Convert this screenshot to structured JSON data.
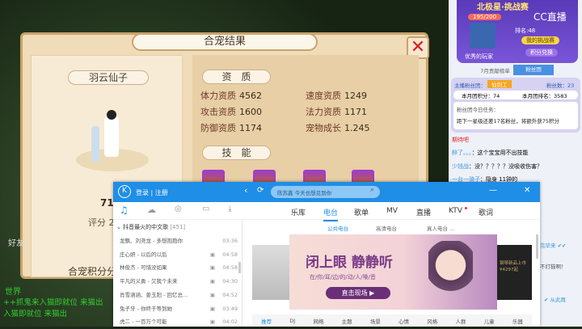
{
  "game": {
    "title": "合宠结果",
    "close": "✕",
    "pet_name": "羽云仙子",
    "score_partial": "71",
    "rating_label": "评分 2",
    "points_label": "合宠积分分",
    "aptitude_header": "资　质",
    "skills_header": "技　能",
    "stats": [
      {
        "label": "体力资质",
        "value": "4562"
      },
      {
        "label": "速度资质",
        "value": "1249"
      },
      {
        "label": "攻击资质",
        "value": "1600"
      },
      {
        "label": "法力资质",
        "value": "1171"
      },
      {
        "label": "防御资质",
        "value": "1174"
      },
      {
        "label": "宠物成长",
        "value": "1.245"
      }
    ],
    "friends": "好友",
    "chat_channel": "世界",
    "chat_lines": [
      "++抓鬼来入猫即就位 来猫出",
      "入猫即就位 来猫出"
    ]
  },
  "kugou": {
    "login": "登录 | 注册",
    "search_placeholder": "陈苏鑫 今天也想见到你",
    "tabs": [
      "乐库",
      "电台",
      "歌单",
      "MV",
      "直播",
      "KTV",
      "歌词"
    ],
    "active_tab": "电台",
    "subtabs": [
      "公共电台",
      "高清电台",
      "真人电台 ..."
    ],
    "playlist_title": "抖音最火的中文歌",
    "playlist_count": "[451]",
    "songs": [
      {
        "name": "龙飘、刘尧龙 - 多想抱抱你",
        "time": "03:36"
      },
      {
        "name": "庄心妍 - 以后的以后",
        "time": "04:58"
      },
      {
        "name": "林俊杰 - 可惜没如果",
        "time": "04:58"
      },
      {
        "name": "平凡的义勇 - 欠我个未来",
        "time": "04:30"
      },
      {
        "name": "肖雪涵涵、姜玉阳 - 回忆总...",
        "time": "04:52"
      },
      {
        "name": "兔子牙 - 你终于等到她",
        "time": "03:49"
      },
      {
        "name": "虎二 - 一百万个可能",
        "time": "04:02"
      }
    ],
    "banner_title": "闭上眼 静静听",
    "banner_sub": "在/你/耳/边/的/动/人/嗓/音",
    "banner_btn": "直击现场",
    "side_ad": "钢琴新品上市 ¥4297起",
    "categories": [
      "推荐",
      "DJ",
      "网络",
      "主题",
      "场景",
      "心情",
      "风格",
      "人群",
      "儿童",
      "乐器"
    ]
  },
  "stream": {
    "brand": "CC直播",
    "event": "北极星·挑战赛",
    "rank": "195/200",
    "anchor": "优秀的玩家",
    "score": "排名:48",
    "btn1": "我的挑战赛",
    "btn2": "积分兑换",
    "tabs": [
      "7月贡献榜单",
      "粉丝团"
    ],
    "fan_label": "主播粉丝团：",
    "fan_badge": "仙剑工",
    "fan_count": "粉丝数：23",
    "month_points": "本月团积分：74",
    "month_rank": "本月团排名：3583",
    "task": "粉丝团今日任务：",
    "task_desc": "距下一星级还差17名粉丝，将额外获75积分",
    "chats": [
      {
        "user": "期待吧",
        "text": ""
      },
      {
        "user": "醉了。。。",
        "text": "这个宝宝用不出技能"
      },
      {
        "user": "少钱战",
        "text": "没？？？？？没吸收伤害？"
      },
      {
        "user": "一台一骑子",
        "text": "隐身 11钟的"
      }
    ],
    "right_snips": [
      "完毕来 ✔✔",
      "不打猫啊！",
      "✔ 从此再"
    ]
  }
}
